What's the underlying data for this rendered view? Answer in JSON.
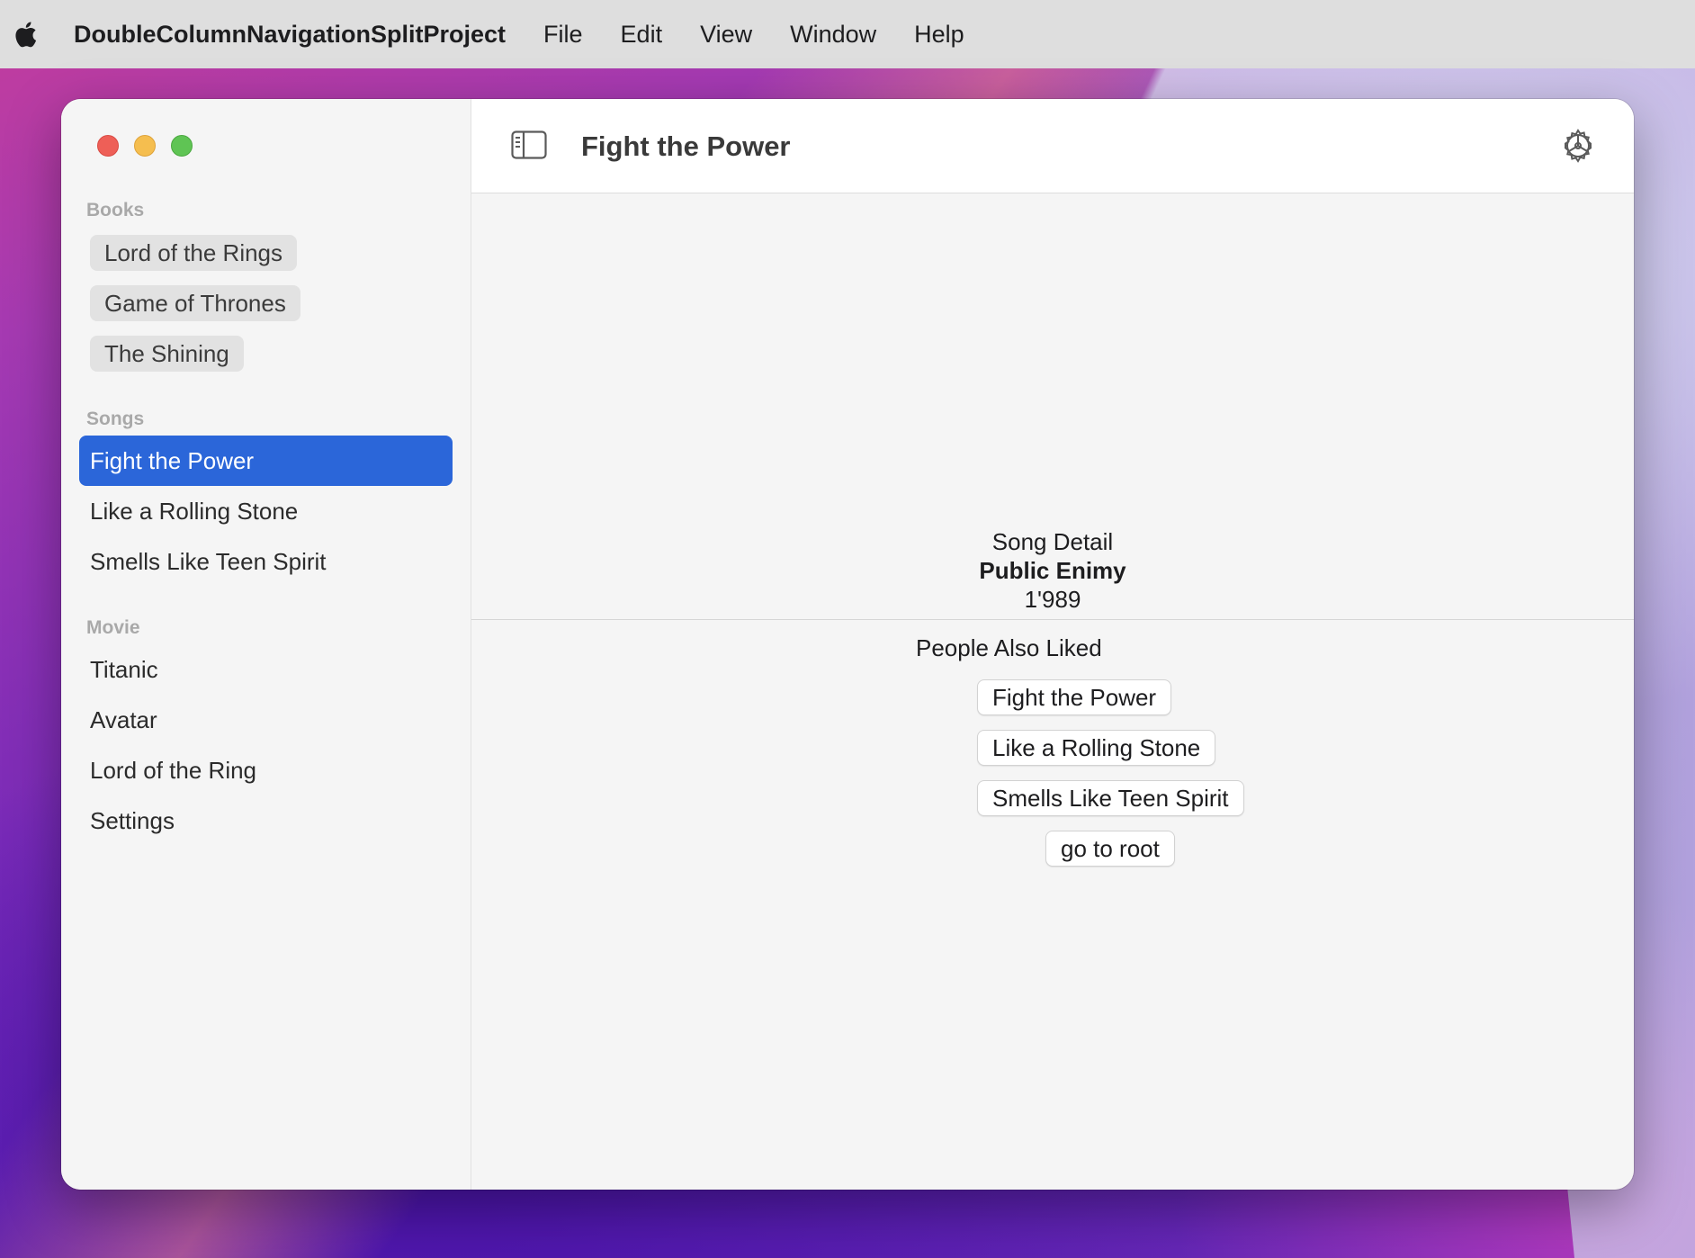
{
  "menubar": {
    "app_name": "DoubleColumnNavigationSplitProject",
    "items": [
      "File",
      "Edit",
      "View",
      "Window",
      "Help"
    ]
  },
  "sidebar": {
    "sections": [
      {
        "title": "Books",
        "items": [
          "Lord of the Rings",
          "Game of Thrones",
          "The Shining"
        ]
      },
      {
        "title": "Songs",
        "items": [
          "Fight the Power",
          "Like a Rolling Stone",
          "Smells Like Teen Spirit"
        ]
      },
      {
        "title": "Movie",
        "items": [
          "Titanic",
          "Avatar",
          "Lord of the Ring",
          "Settings"
        ]
      }
    ],
    "selected": "Fight the Power"
  },
  "detail": {
    "title": "Fight the Power",
    "song_label": "Song Detail",
    "artist": "Public Enimy",
    "year": "1'989",
    "also_liked_title": "People Also Liked",
    "also_liked": [
      "Fight the Power",
      "Like a Rolling Stone",
      "Smells Like Teen Spirit"
    ],
    "root_button": "go to root"
  },
  "colors": {
    "selection": "#2b66d9",
    "close": "#ee5f57",
    "minimize": "#f5be4f",
    "zoom": "#5fc454"
  },
  "icons": [
    "apple-icon",
    "sidebar-toggle-icon",
    "gear-icon"
  ]
}
